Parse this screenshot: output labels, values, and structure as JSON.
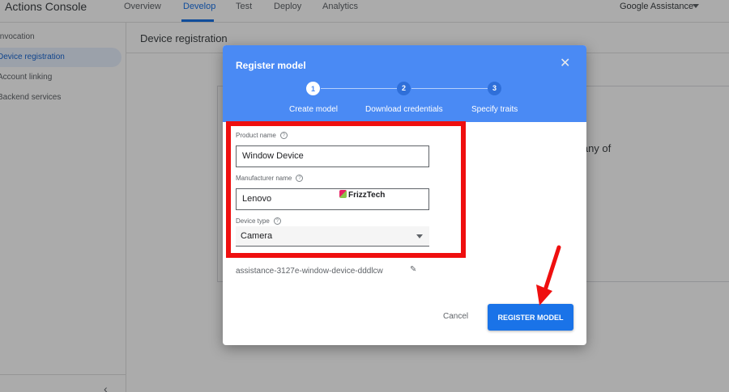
{
  "app": {
    "title": "Actions Console"
  },
  "nav": {
    "tabs": [
      {
        "label": "Overview"
      },
      {
        "label": "Develop"
      },
      {
        "label": "Test"
      },
      {
        "label": "Deploy"
      },
      {
        "label": "Analytics"
      }
    ],
    "active_tab": "Develop",
    "project": "Google Assistance"
  },
  "sidebar": {
    "items": [
      {
        "label": "Invocation"
      },
      {
        "label": "Device registration"
      },
      {
        "label": "Account linking"
      },
      {
        "label": "Backend services"
      }
    ],
    "active_item": "Device registration",
    "collapse_icon": "chevron-left-icon"
  },
  "main": {
    "title": "Device registration",
    "background_text": "o any of"
  },
  "dialog": {
    "title": "Register model",
    "steps": [
      {
        "number": "1",
        "label": "Create model",
        "state": "current"
      },
      {
        "number": "2",
        "label": "Download credentials",
        "state": "pending"
      },
      {
        "number": "3",
        "label": "Specify traits",
        "state": "pending"
      }
    ],
    "fields": {
      "product_name": {
        "label": "Product name",
        "value": "Window Device"
      },
      "manufacturer_name": {
        "label": "Manufacturer name",
        "value": "Lenovo"
      },
      "device_type": {
        "label": "Device type",
        "value": "Camera"
      }
    },
    "model_id": "assistance-3127e-window-device-dddlcw",
    "buttons": {
      "cancel": "Cancel",
      "register": "REGISTER MODEL"
    }
  },
  "annotations": {
    "watermark": "FrizzTech",
    "highlight_color": "#ef0f0f"
  },
  "colors": {
    "header_blue": "#4a8af4",
    "accent": "#1a73e8"
  }
}
